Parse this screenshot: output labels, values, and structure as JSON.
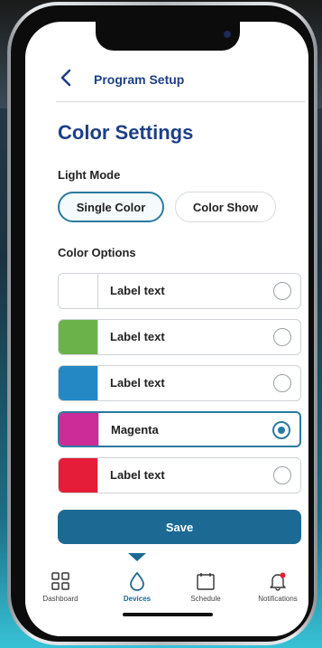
{
  "header": {
    "title": "Program Setup"
  },
  "page_title": "Color Settings",
  "light_mode": {
    "label": "Light  Mode",
    "options": [
      {
        "label": "Single Color",
        "active": true
      },
      {
        "label": "Color Show",
        "active": false
      }
    ]
  },
  "color_options": {
    "label": "Color Options",
    "items": [
      {
        "label": "Label text",
        "color": "#ffffff",
        "selected": false
      },
      {
        "label": "Label text",
        "color": "#6cb24a",
        "selected": false
      },
      {
        "label": "Label text",
        "color": "#2388c4",
        "selected": false
      },
      {
        "label": "Magenta",
        "color": "#cb2c97",
        "selected": true
      },
      {
        "label": "Label text",
        "color": "#e51d38",
        "selected": false
      }
    ]
  },
  "save_label": "Save",
  "nav": {
    "items": [
      {
        "label": "Dashboard",
        "icon": "grid-icon"
      },
      {
        "label": "Devices",
        "icon": "droplet-icon",
        "active": true
      },
      {
        "label": "Schedule",
        "icon": "calendar-icon"
      },
      {
        "label": "Notifications",
        "icon": "bell-icon"
      }
    ]
  },
  "colors": {
    "primary": "#1d3f86",
    "accent": "#1c6a94",
    "notification_dot": "#e51d38"
  }
}
